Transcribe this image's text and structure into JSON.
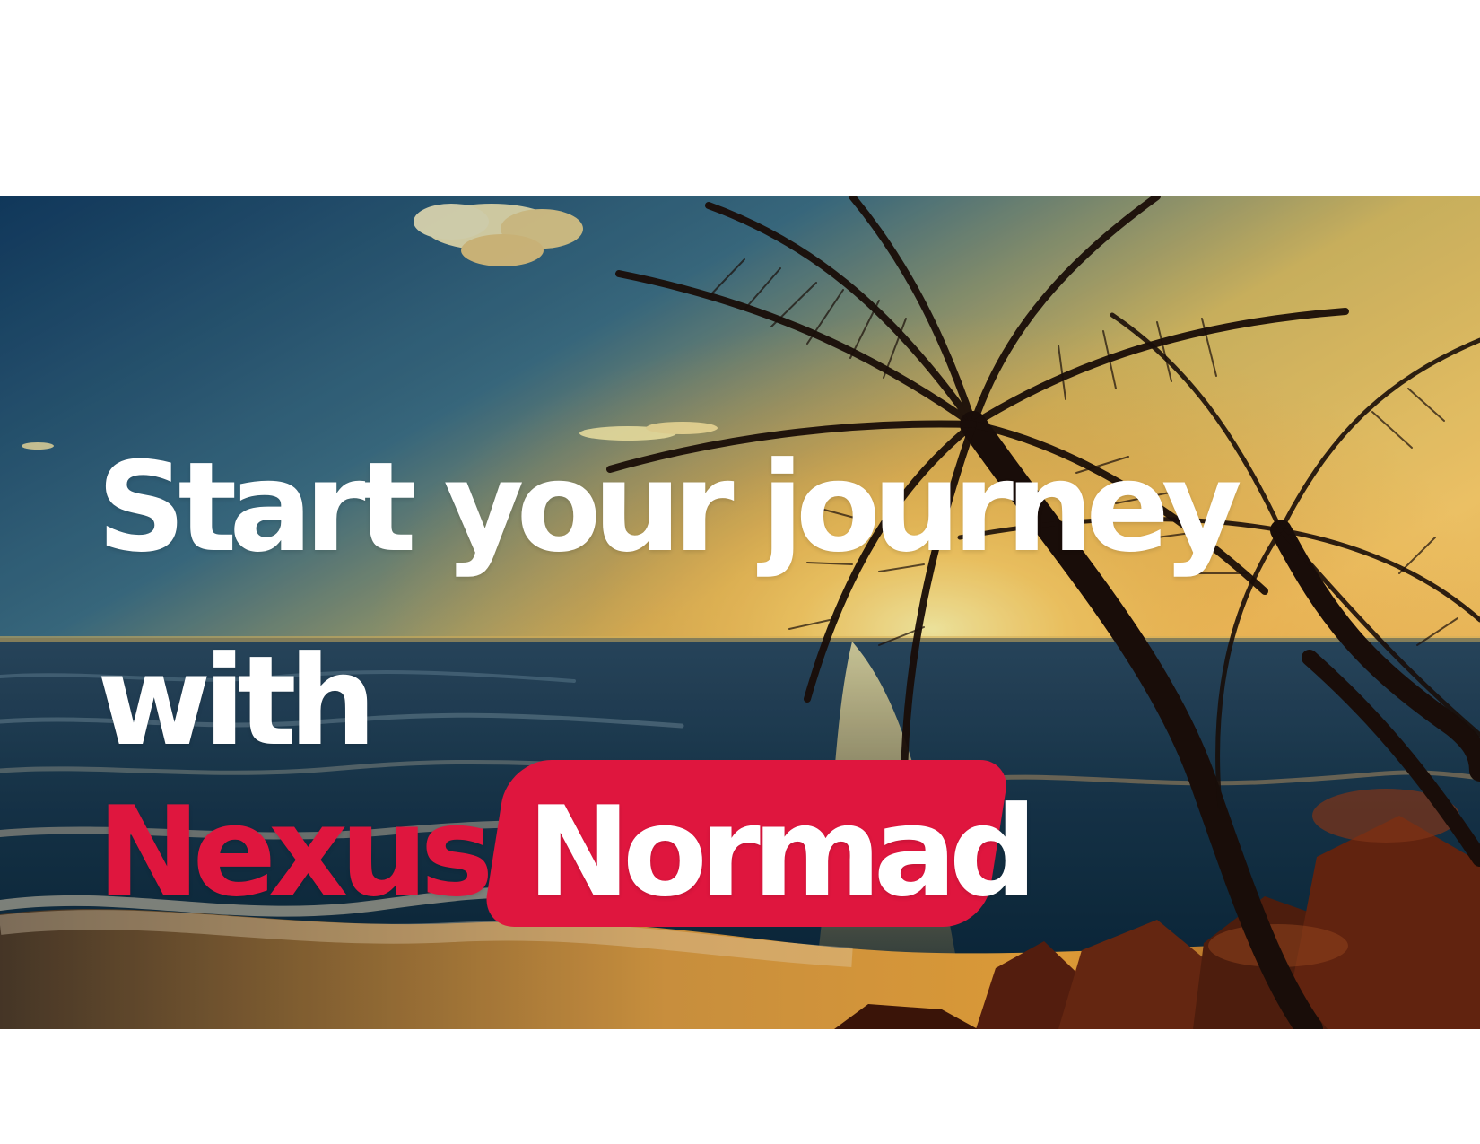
{
  "headline": {
    "line_1": "Start your journey",
    "line_2": "with",
    "brand": {
      "first": "Nexus",
      "second": "Normad"
    }
  },
  "colors": {
    "brand_red": "#df163e",
    "headline_text": "#ffffff",
    "page_background": "#ffffff"
  },
  "image": {
    "subject": "tropical beach sunset with palm trees"
  }
}
